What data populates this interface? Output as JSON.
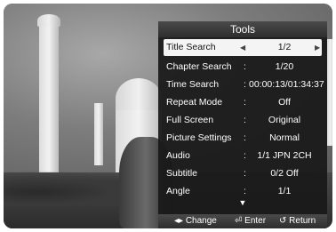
{
  "panel": {
    "title": "Tools",
    "rows": [
      {
        "label": "Title Search",
        "sep": "",
        "value": "1/2",
        "selected": true
      },
      {
        "label": "Chapter Search",
        "sep": ":",
        "value": "1/20"
      },
      {
        "label": "Time Search",
        "sep": ":",
        "value": "00:00:13/01:34:37"
      },
      {
        "label": "Repeat Mode",
        "sep": ":",
        "value": "Off"
      },
      {
        "label": "Full Screen",
        "sep": ":",
        "value": "Original"
      },
      {
        "label": "Picture Settings",
        "sep": ":",
        "value": "Normal"
      },
      {
        "label": "Audio",
        "sep": ":",
        "value": "1/1 JPN 2CH"
      },
      {
        "label": "Subtitle",
        "sep": ":",
        "value": "0/2 Off"
      },
      {
        "label": "Angle",
        "sep": ":",
        "value": "1/1"
      }
    ],
    "more_indicator": "▼",
    "footer": {
      "change_icon": "left-right-arrows-icon",
      "change_label": "◂▸ Change",
      "enter_label": "⏎ Enter",
      "return_label": "↺ Return"
    }
  }
}
